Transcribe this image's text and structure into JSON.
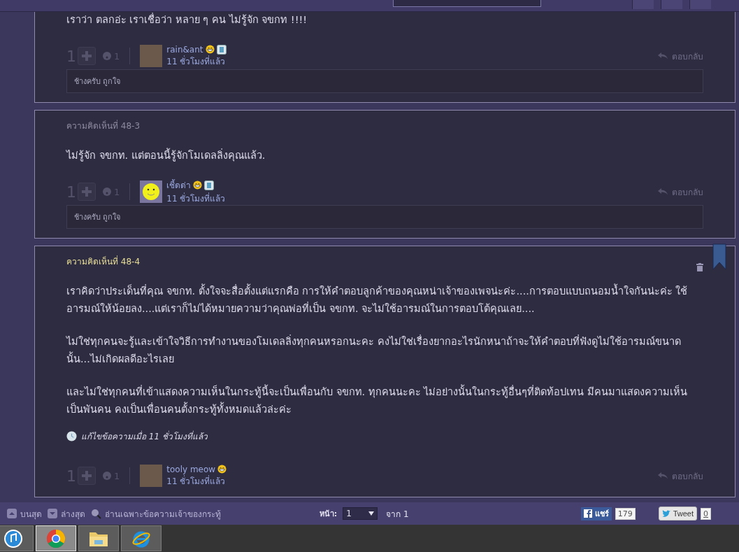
{
  "comments": [
    {
      "highlighted": false,
      "paragraphs": [
        "เราว่า ตลกอ่ะ เราเชื่อว่า หลาย ๆ คน ไม่รู้จัก จขกท !!!!"
      ],
      "votes": "1",
      "reactions": "1",
      "user": {
        "name": "rain&ant",
        "avatar": {
          "kind": "photo"
        },
        "badges": [
          {
            "kind": "grin"
          },
          {
            "kind": "blog"
          }
        ]
      },
      "time": "11 ชั่วโมงที่แล้ว",
      "reply": "ตอบกลับ",
      "reply_box": "ช้างครับ ถูกใจ"
    },
    {
      "header": "ความคิดเห็นที่ 48-3",
      "highlighted": false,
      "paragraphs": [
        "ไม่รู้จัก จขกท. แต่ตอนนี้รู้จักโมเดลลิ่งคุณแล้ว."
      ],
      "votes": "1",
      "reactions": "1",
      "user": {
        "name": "เชี้ดด่า",
        "avatar": {
          "kind": "smiley"
        },
        "badges": [
          {
            "kind": "grin"
          },
          {
            "kind": "blog"
          }
        ]
      },
      "time": "11 ชั่วโมงที่แล้ว",
      "reply": "ตอบกลับ",
      "reply_box": "ช้างครับ ถูกใจ"
    },
    {
      "header": "ความคิดเห็นที่ 48-4",
      "highlighted": true,
      "paragraphs": [
        "เราคิดว่าประเด็นที่คุณ จขกท. ตั้งใจจะสื่อตั้งแต่แรกคือ การให้คำตอบลูกค้าของคุณหน่าเจ้าของเพจน่ะค่ะ....การตอบแบบถนอมน้ำใจกันน่ะค่ะ ใช้อารมณ์ให้น้อยลง....แต่เราก็ไม่ได้หมายความว่าคุณพ่อที่เป็น จขกท. จะไม่ใช้อารมณ์ในการตอบโต้คุณเลย....",
        "ไม่ใช่ทุกคนจะรู้และเข้าใจวิธีการทำงานของโมเดลลิ่งทุกคนหรอกนะคะ คงไม่ใช่เรื่องยากอะไรนักหนาถ้าจะให้คำตอบที่ฟังดูไม่ใช้อารมณ์ขนาดนั้น...ไม่เกิดผลดีอะไรเลย",
        "และไม่ใช่ทุกคนที่เข้าแสดงความเห็นในกระทู้นี้จะเป็นเพื่อนกับ จขกท. ทุกคนนะคะ ไม่อย่างนั้นในกระทู้อื่นๆที่ติดท้อปเทน มีคนมาแสดงความเห็นเป็นพันคน คงเป็นเพื่อนคนตั้งกระทู้ทั้งหมดแล้วล่ะค่ะ"
      ],
      "edited": "แก้ไขข้อความเมื่อ 11  ชั่วโมงที่แล้ว",
      "votes": "1",
      "reactions": "1",
      "user": {
        "name": "tooly meow",
        "avatar": {
          "kind": "photo"
        },
        "badges": [
          {
            "kind": "grin"
          }
        ]
      },
      "time": "11 ชั่วโมงที่แล้ว",
      "reply": "ตอบกลับ"
    }
  ],
  "bottom_bar": {
    "top": "บนสุด",
    "bottom": "ล่างสุด",
    "owner_only": "อ่านเฉพาะข้อความเจ้าของกระทู้",
    "page_label": "หน้า:",
    "page": "1",
    "page_total": "จาก 1",
    "share": "แชร์",
    "share_count": "179",
    "tweet": "Tweet",
    "tweet_count": "0"
  },
  "taskbar": [
    {
      "kind": "music",
      "selected": false
    },
    {
      "kind": "chrome",
      "selected": true
    },
    {
      "kind": "folder",
      "selected": false
    },
    {
      "kind": "ie",
      "selected": false
    }
  ]
}
